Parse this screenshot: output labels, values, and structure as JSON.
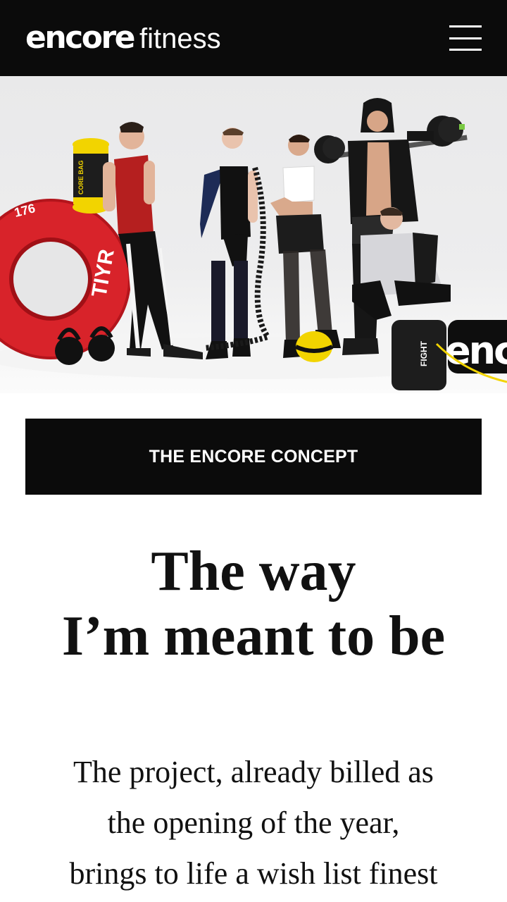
{
  "header": {
    "logo_brand": "encore",
    "logo_sub": "fitness",
    "menu_icon": "hamburger-icon"
  },
  "hero": {
    "colors": {
      "tire": "#d8232a",
      "background": "#ececed",
      "accent_yellow": "#f2d400"
    },
    "tire_number": "176",
    "tire_brand": "TIYR",
    "bag_label": "CORE BAG",
    "fight_bag_label": "FIGHT",
    "bag_brand": "enc"
  },
  "concept": {
    "label": "THE ENCORE CONCEPT"
  },
  "headline": {
    "line1": "The way",
    "line2": "I’m meant to be"
  },
  "intro": {
    "line1": "The project, already billed as",
    "line2": "the opening of the year,",
    "line3": "brings to life a wish list finest"
  }
}
